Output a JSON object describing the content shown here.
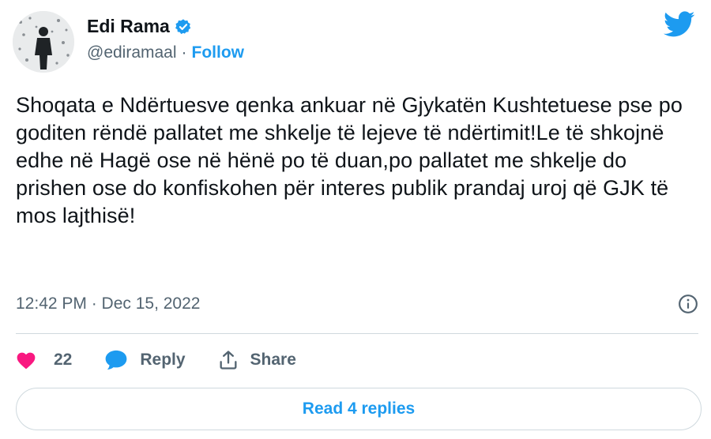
{
  "author": {
    "display_name": "Edi Rama",
    "handle": "@ediramaal",
    "separator": "·",
    "follow_label": "Follow"
  },
  "tweet": {
    "text": "Shoqata e Ndërtuesve qenka ankuar në Gjykatën Kushtetuese pse po goditen rëndë pallatet me shkelje të lejeve të ndërtimit!Le të shkojnë edhe në Hagë ose në hënë po të duan,po pallatet me shkelje do prishen ose do konfiskohen për interes publik prandaj uroj që GJK të mos lajthisë!",
    "timestamp": "12:42 PM · Dec 15, 2022"
  },
  "actions": {
    "like_count": "22",
    "reply_label": "Reply",
    "share_label": "Share"
  },
  "read_replies_label": "Read 4 replies",
  "icons": {
    "verified": "verified-badge-icon",
    "bird": "twitter-bird-icon",
    "info": "info-icon",
    "like": "heart-icon",
    "reply": "reply-bubble-icon",
    "share": "share-icon"
  },
  "colors": {
    "accent": "#1d9bf0",
    "like": "#f91880",
    "muted": "#536471",
    "text": "#0f1419"
  }
}
